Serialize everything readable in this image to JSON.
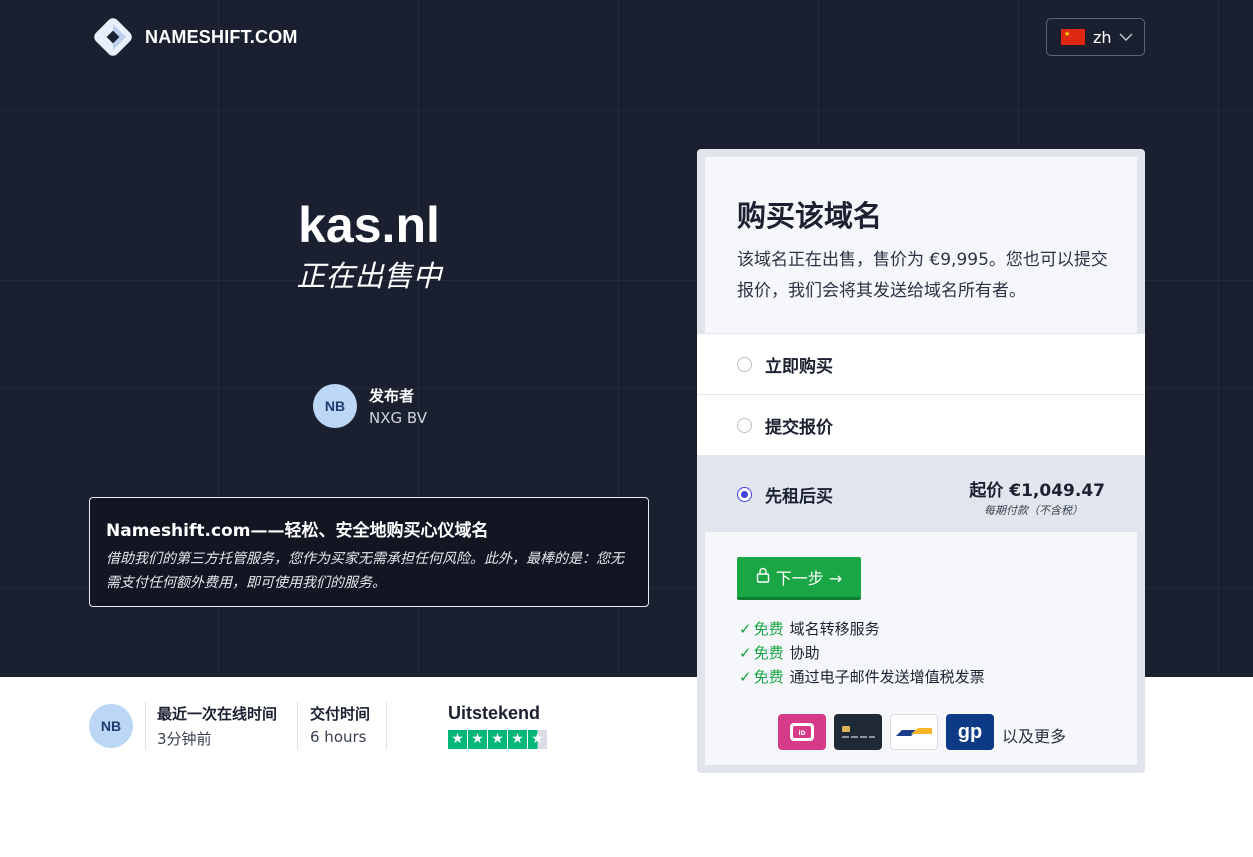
{
  "header": {
    "logo_text": "NAMESHIFT.COM",
    "language": {
      "code": "zh",
      "flag_icon": "china-flag-icon"
    }
  },
  "hero": {
    "domain": "kas.nl",
    "subtitle": "正在出售中",
    "publisher": {
      "initials": "NB",
      "label": "发布者",
      "name": "NXG BV"
    },
    "escrow": {
      "title": "Nameshift.com——轻松、安全地购买心仪域名",
      "text": "借助我们的第三方托管服务，您作为买家无需承担任何风险。此外，最棒的是：您无需支付任何额外费用，即可使用我们的服务。"
    }
  },
  "stats": {
    "initials": "NB",
    "last_online_label": "最近一次在线时间",
    "last_online_value": "3分钟前",
    "transfer_label": "交付时间",
    "transfer_value": "6 hours",
    "trustpilot_label": "Uitstekend",
    "trustpilot_rating": 4.5
  },
  "purchase": {
    "title": "购买该域名",
    "description": "该域名正在出售，售价为 €9,995。您也可以提交报价，我们会将其发送给域名所有者。",
    "options": [
      {
        "label": "立即购买",
        "selected": false
      },
      {
        "label": "提交报价",
        "selected": false
      },
      {
        "label": "先租后买",
        "selected": true,
        "price": "起价 €1,049.47",
        "price_note": "每期付款（不含税）"
      }
    ],
    "next_button": "下一步 →",
    "features": [
      {
        "free": "免费",
        "text": "域名转移服务"
      },
      {
        "free": "免费",
        "text": "协助"
      },
      {
        "free": "免费",
        "text": "通过电子邮件发送增值税发票"
      }
    ],
    "payment_methods": [
      "ideal-icon",
      "card-icon",
      "bancontact-icon",
      "giropay-icon"
    ],
    "giropay_text": "gp",
    "more_text": "以及更多"
  },
  "colors": {
    "hero_bg": "#1a2030",
    "accent_green": "#1aa645",
    "radio_blue": "#3f43d6"
  }
}
